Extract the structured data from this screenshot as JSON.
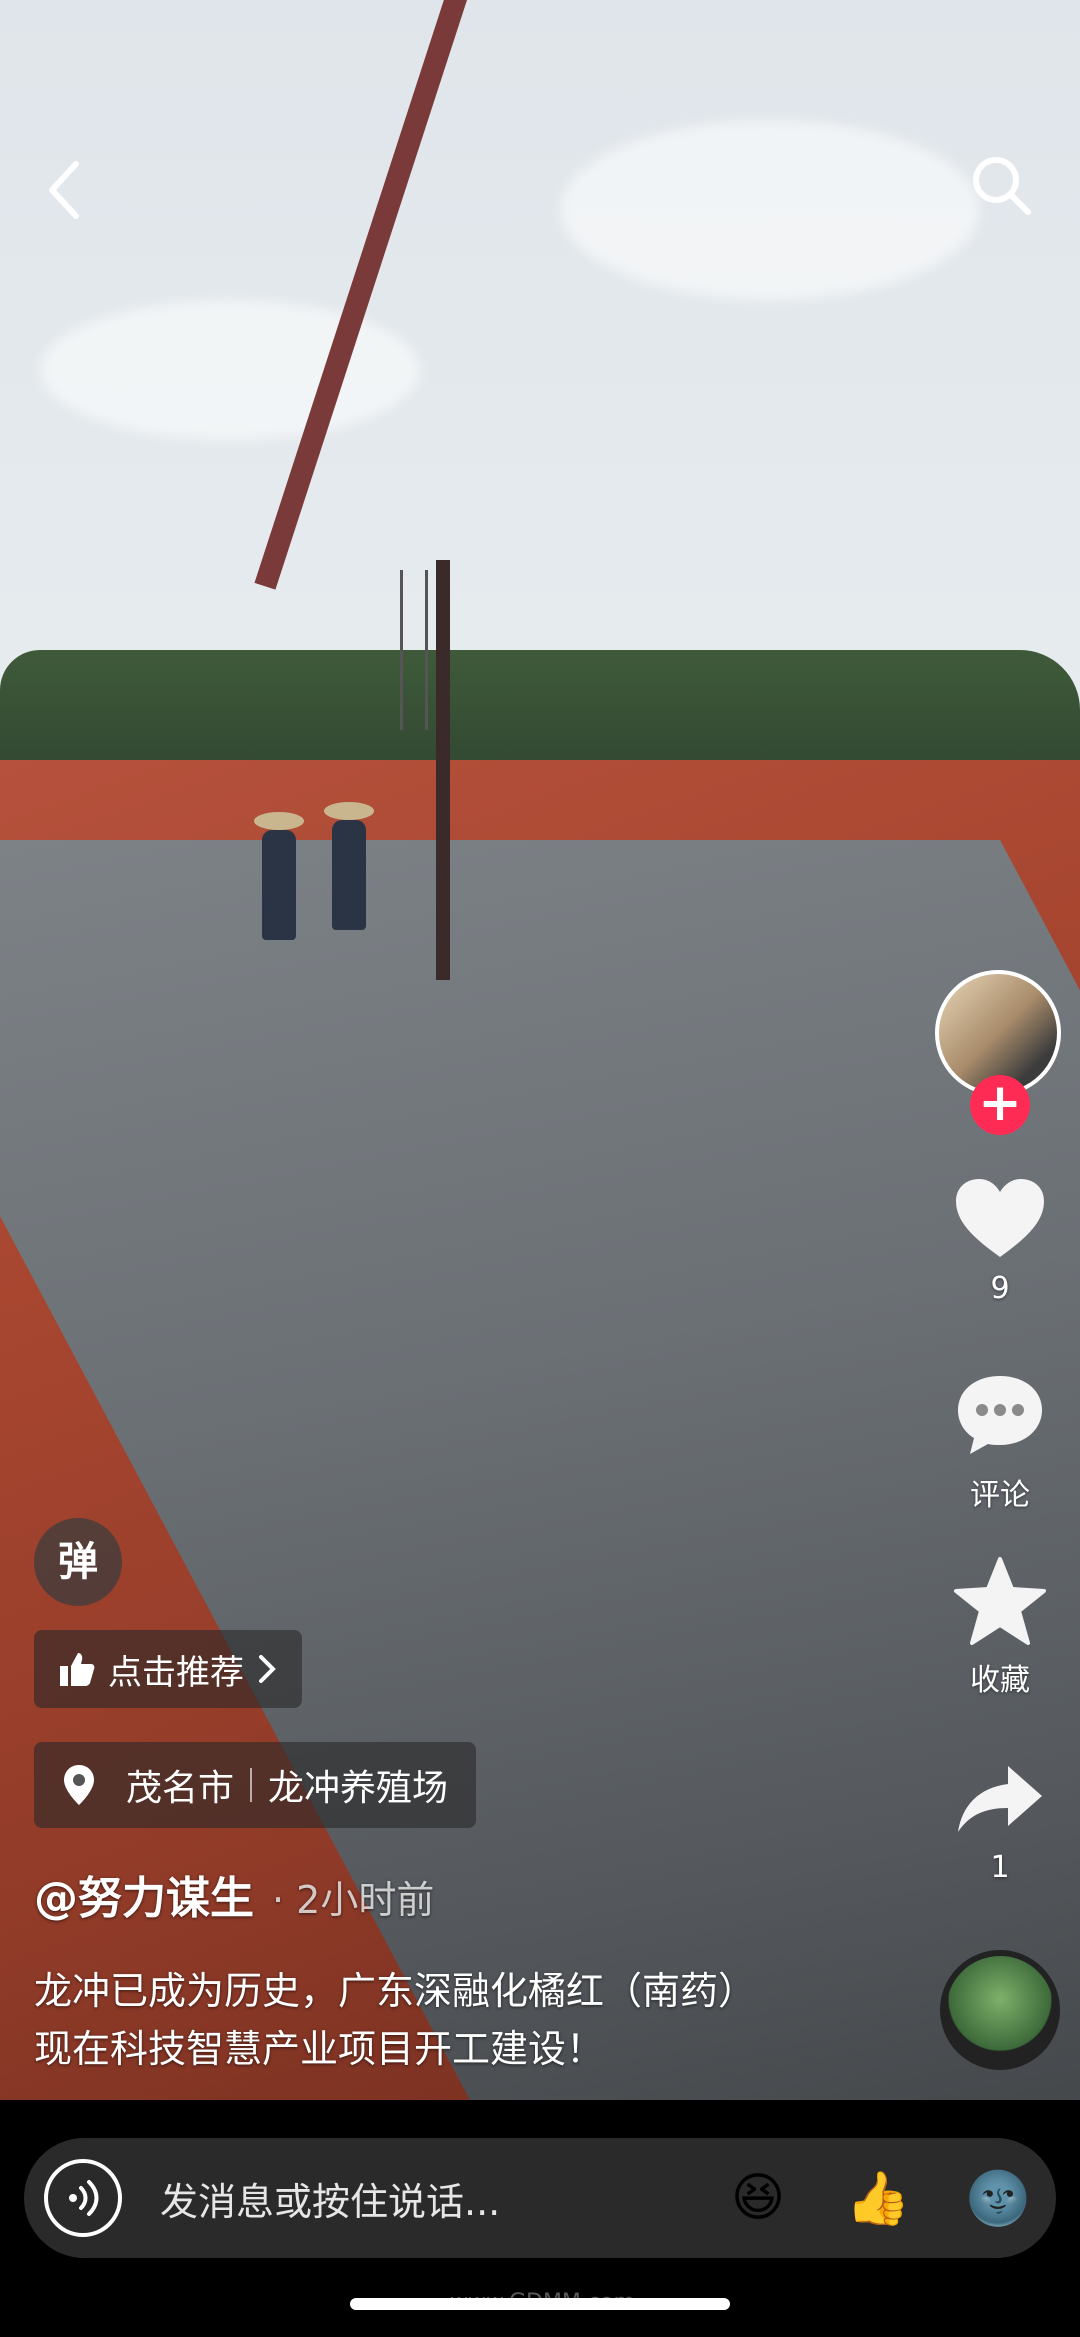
{
  "top_bar": {
    "back_icon": "chevron-left-icon",
    "search_icon": "search-icon"
  },
  "right_rail": {
    "follow_icon": "plus-icon",
    "like_count": "9",
    "comment_label": "评论",
    "favorite_label": "收藏",
    "share_count": "1",
    "colors": {
      "follow": "#fe2c55",
      "icon": "#ffffff"
    }
  },
  "overlay": {
    "danmu_label": "弹",
    "recommend_label": "点击推荐",
    "location": {
      "city": "茂名市",
      "place": "龙冲养殖场"
    },
    "author": "@努力谋生",
    "time": "2小时前",
    "caption": "龙冲已成为历史，广东深融化橘红（南药）现在科技智慧产业项目开工建设！"
  },
  "bottom_bar": {
    "placeholder": "发消息或按住说话...",
    "emojis": [
      "😆",
      "👍",
      "🌚"
    ]
  },
  "watermark": "www.GDMM.com"
}
